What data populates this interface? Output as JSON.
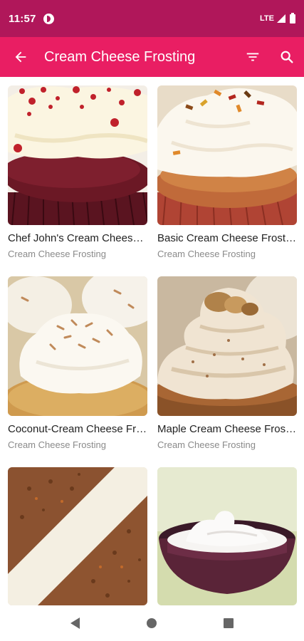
{
  "status_bar": {
    "time": "11:57",
    "network": "LTE"
  },
  "app_bar": {
    "title": "Cream Cheese Frosting",
    "icons": [
      "arrow-back-icon",
      "filter-icon",
      "search-icon"
    ]
  },
  "recipes": [
    {
      "title": "Chef John's Cream Cheese Frosting",
      "category": "Cream Cheese Frosting",
      "image": "red-velvet-cupcake"
    },
    {
      "title": "Basic Cream Cheese Frosting",
      "category": "Cream Cheese Frosting",
      "image": "sprinkle-cupcake"
    },
    {
      "title": "Coconut-Cream Cheese Frosting",
      "category": "Cream Cheese Frosting",
      "image": "coconut-cupcake"
    },
    {
      "title": "Maple Cream Cheese Frosting",
      "category": "Cream Cheese Frosting",
      "image": "maple-walnut-cupcake"
    },
    {
      "title": "",
      "category": "",
      "image": "carrot-cake-slice"
    },
    {
      "title": "",
      "category": "",
      "image": "frosting-bowl"
    }
  ],
  "colors": {
    "status_bar": "#b0175a",
    "app_bar": "#e91e63"
  }
}
